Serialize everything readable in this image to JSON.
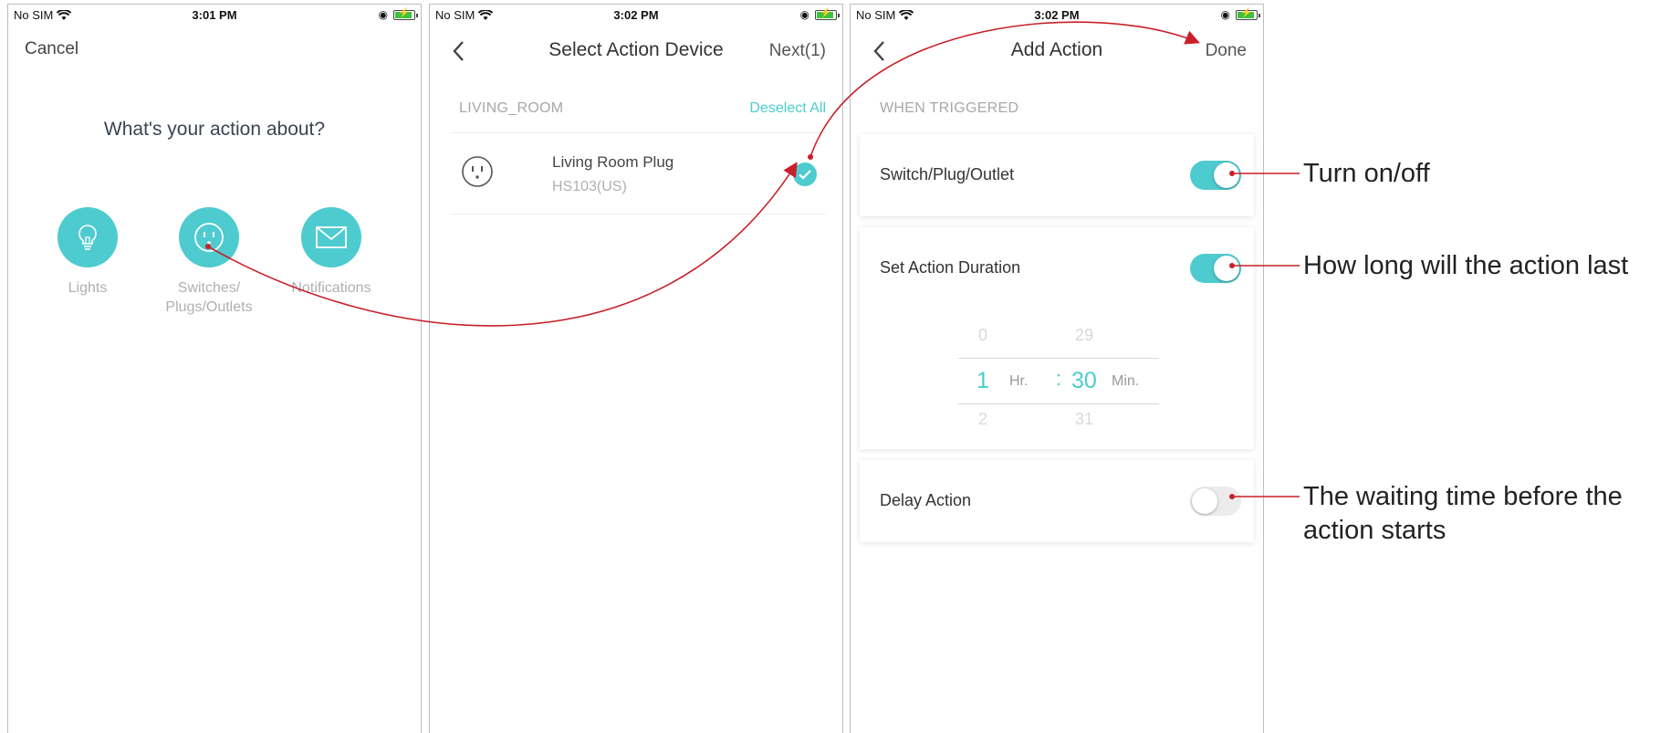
{
  "status_bars": [
    {
      "carrier": "No SIM",
      "time": "3:01 PM"
    },
    {
      "carrier": "No SIM",
      "time": "3:02 PM"
    },
    {
      "carrier": "No SIM",
      "time": "3:02 PM"
    }
  ],
  "screen1": {
    "cancel_label": "Cancel",
    "question": "What's your action about?",
    "options": [
      {
        "label": "Lights",
        "icon": "lightbulb-icon"
      },
      {
        "label": "Switches/\nPlugs/Outlets",
        "icon": "outlet-icon"
      },
      {
        "label": "Notifications",
        "icon": "envelope-icon"
      }
    ]
  },
  "screen2": {
    "title": "Select Action Device",
    "next_label": "Next(1)",
    "section_label": "LIVING_ROOM",
    "deselect_label": "Deselect All",
    "device": {
      "name": "Living Room Plug",
      "model": "HS103(US)",
      "icon": "outlet-icon",
      "selected": true
    }
  },
  "screen3": {
    "title": "Add Action",
    "done_label": "Done",
    "section_label": "WHEN TRIGGERED",
    "cards": [
      {
        "label": "Switch/Plug/Outlet",
        "toggle_on": true
      },
      {
        "label": "Set Action Duration",
        "toggle_on": true
      },
      {
        "label": "Delay Action",
        "toggle_on": false
      }
    ],
    "picker": {
      "hours_prev": "0",
      "hours": "1",
      "hours_next": "2",
      "hours_unit": "Hr.",
      "separator": ":",
      "minutes_prev": "29",
      "minutes": "30",
      "minutes_next": "31",
      "minutes_unit": "Min."
    }
  },
  "annotations": {
    "switch": "Turn on/off",
    "duration": "How long will the action last",
    "delay_line1": "The waiting time before the",
    "delay_line2": "action starts"
  },
  "colors": {
    "accent": "#4ecbcf",
    "arrow": "#c8202a"
  }
}
